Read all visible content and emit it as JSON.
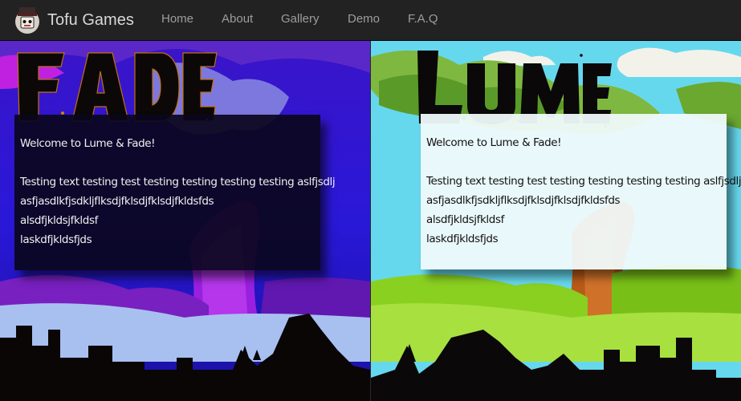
{
  "navbar": {
    "brand": "Tofu Games",
    "logo_icon": "tofu-mascot-icon",
    "items": [
      "Home",
      "About",
      "Gallery",
      "Demo",
      "F.A.Q"
    ]
  },
  "left_panel": {
    "title": "FADE",
    "theme": "dark",
    "card": {
      "welcome": "Welcome to Lume & Fade!",
      "lines": [
        "Testing text testing test testing testing testing testing aslfjsdlj",
        "asfjasdlkfjsdkljflksdjfklsdjfklsdjfkldsfds",
        "alsdfjkldsjfkldsf",
        "laskdfjkldsfjds"
      ]
    }
  },
  "right_panel": {
    "title": "LUME",
    "theme": "light",
    "card": {
      "welcome": "Welcome to Lume & Fade!",
      "lines": [
        "Testing text testing test testing testing testing testing aslfjsdlj",
        "asfjasdlkfjsdkljflksdjfklsdjfklsdjfkldsfds",
        "alsdfjkldsjfkldsf",
        "laskdfjkldsfjds"
      ]
    }
  },
  "colors": {
    "navbar_bg": "#222222",
    "nav_text": "#9d9d9d",
    "brand_text": "#d8d8d8",
    "fade_sky": "#2a10c8",
    "fade_accent": "#b020e0",
    "lume_sky": "#5fd8ee",
    "lume_grass": "#7fcc20",
    "card_dark": "#0a061e",
    "card_light": "#f0fafa"
  }
}
